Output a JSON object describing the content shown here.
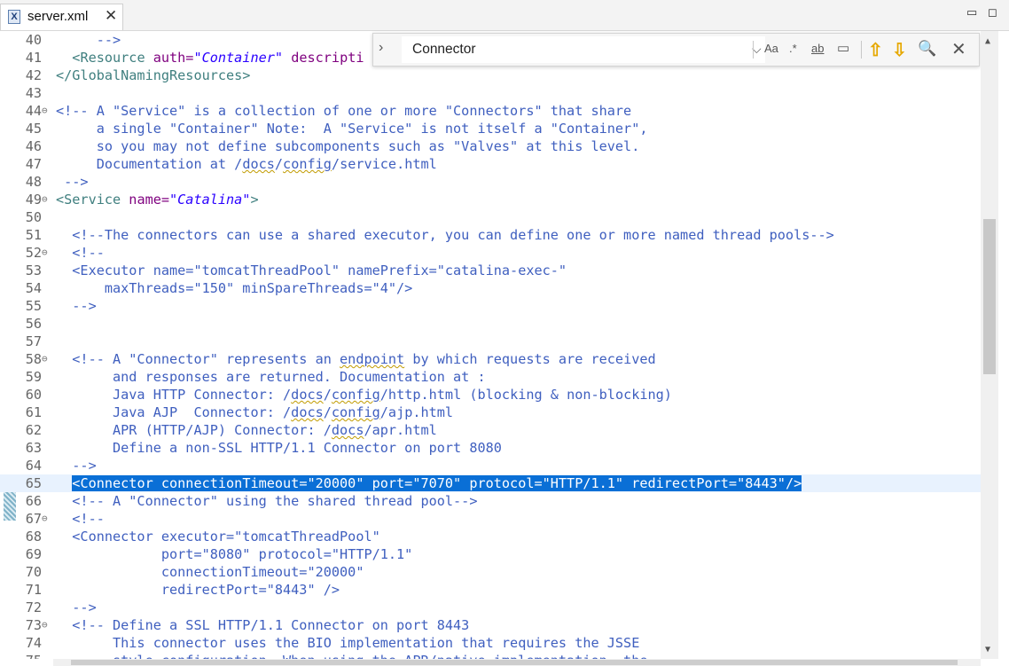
{
  "tab": {
    "file_name": "server.xml",
    "icon": "xml-file-icon",
    "close_glyph": "✕"
  },
  "window_controls": {
    "minimize": "▭",
    "maximize": "◻"
  },
  "find": {
    "query": "Connector",
    "toggle_glyph": "›",
    "history_glyph": "⌵",
    "match_case": "Aa",
    "regex": ".*",
    "whole_word": "ab",
    "in_selection": "▭",
    "prev_glyph": "⇧",
    "next_glyph": "⇩",
    "search_glyph": "🔍",
    "close_glyph": "✕"
  },
  "editor": {
    "lines": [
      {
        "n": "40",
        "fold": "",
        "segs": [
          [
            "c",
            "     -->"
          ]
        ]
      },
      {
        "n": "41",
        "fold": "",
        "segs": [
          [
            "c",
            "  "
          ],
          [
            "t",
            "<Resource "
          ],
          [
            "a",
            "auth="
          ],
          [
            "v",
            "\"Container\""
          ],
          [
            "c",
            " "
          ],
          [
            "a",
            "descripti"
          ]
        ]
      },
      {
        "n": "42",
        "fold": "",
        "segs": [
          [
            "t",
            "</GlobalNamingResources>"
          ]
        ]
      },
      {
        "n": "43",
        "fold": "",
        "segs": [
          [
            "c",
            ""
          ]
        ]
      },
      {
        "n": "44",
        "fold": "⊖",
        "segs": [
          [
            "c",
            "<!-- A \"Service\" is a collection of one or more \"Connectors\" that share"
          ]
        ]
      },
      {
        "n": "45",
        "fold": "",
        "segs": [
          [
            "c",
            "     a single \"Container\" Note:  A \"Service\" is not itself a \"Container\","
          ]
        ]
      },
      {
        "n": "46",
        "fold": "",
        "segs": [
          [
            "c",
            "     so you may not define subcomponents such as \"Valves\" at this level."
          ]
        ]
      },
      {
        "n": "47",
        "fold": "",
        "segs": [
          [
            "c",
            "     Documentation at /"
          ],
          [
            "s",
            "docs"
          ],
          [
            "c",
            "/"
          ],
          [
            "s",
            "config"
          ],
          [
            "c",
            "/service.html"
          ]
        ]
      },
      {
        "n": "48",
        "fold": "",
        "segs": [
          [
            "c",
            " -->"
          ]
        ]
      },
      {
        "n": "49",
        "fold": "⊖",
        "segs": [
          [
            "t",
            "<Service "
          ],
          [
            "a",
            "name="
          ],
          [
            "v",
            "\"Catalina\""
          ],
          [
            "t",
            ">"
          ]
        ]
      },
      {
        "n": "50",
        "fold": "",
        "segs": [
          [
            "c",
            ""
          ]
        ]
      },
      {
        "n": "51",
        "fold": "",
        "segs": [
          [
            "c",
            "  <!--The connectors can use a shared executor, you can define one or more named thread pools-->"
          ]
        ]
      },
      {
        "n": "52",
        "fold": "⊖",
        "segs": [
          [
            "c",
            "  <!--"
          ]
        ]
      },
      {
        "n": "53",
        "fold": "",
        "segs": [
          [
            "c",
            "  <Executor name=\"tomcatThreadPool\" namePrefix=\"catalina-exec-\""
          ]
        ]
      },
      {
        "n": "54",
        "fold": "",
        "segs": [
          [
            "c",
            "      maxThreads=\"150\" minSpareThreads=\"4\"/>"
          ]
        ]
      },
      {
        "n": "55",
        "fold": "",
        "segs": [
          [
            "c",
            "  -->"
          ]
        ]
      },
      {
        "n": "56",
        "fold": "",
        "segs": [
          [
            "c",
            ""
          ]
        ]
      },
      {
        "n": "57",
        "fold": "",
        "segs": [
          [
            "c",
            ""
          ]
        ]
      },
      {
        "n": "58",
        "fold": "⊖",
        "segs": [
          [
            "c",
            "  <!-- A \"Connector\" represents an "
          ],
          [
            "s",
            "endpoint"
          ],
          [
            "c",
            " by which requests are received"
          ]
        ]
      },
      {
        "n": "59",
        "fold": "",
        "segs": [
          [
            "c",
            "       and responses are returned. Documentation at :"
          ]
        ]
      },
      {
        "n": "60",
        "fold": "",
        "segs": [
          [
            "c",
            "       Java HTTP Connector: /"
          ],
          [
            "s",
            "docs"
          ],
          [
            "c",
            "/"
          ],
          [
            "s",
            "config"
          ],
          [
            "c",
            "/http.html (blocking & non-blocking)"
          ]
        ]
      },
      {
        "n": "61",
        "fold": "",
        "segs": [
          [
            "c",
            "       Java AJP  Connector: /"
          ],
          [
            "s",
            "docs"
          ],
          [
            "c",
            "/"
          ],
          [
            "s",
            "config"
          ],
          [
            "c",
            "/ajp.html"
          ]
        ]
      },
      {
        "n": "62",
        "fold": "",
        "segs": [
          [
            "c",
            "       APR (HTTP/AJP) Connector: /"
          ],
          [
            "s",
            "docs"
          ],
          [
            "c",
            "/apr.html"
          ]
        ]
      },
      {
        "n": "63",
        "fold": "",
        "segs": [
          [
            "c",
            "       Define a non-SSL HTTP/1.1 Connector on port 8080"
          ]
        ]
      },
      {
        "n": "64",
        "fold": "",
        "segs": [
          [
            "c",
            "  -->"
          ]
        ]
      },
      {
        "n": "65",
        "fold": "",
        "hl": true,
        "pre": "  ",
        "sel": "<Connector connectionTimeout=\"20000\" port=\"7070\" protocol=\"HTTP/1.1\" redirectPort=\"8443\"/>"
      },
      {
        "n": "66",
        "fold": "",
        "segs": [
          [
            "c",
            "  <!-- A \"Connector\" using the shared thread pool-->"
          ]
        ]
      },
      {
        "n": "67",
        "fold": "⊖",
        "segs": [
          [
            "c",
            "  <!--"
          ]
        ]
      },
      {
        "n": "68",
        "fold": "",
        "segs": [
          [
            "c",
            "  <Connector executor=\"tomcatThreadPool\""
          ]
        ]
      },
      {
        "n": "69",
        "fold": "",
        "segs": [
          [
            "c",
            "             port=\"8080\" protocol=\"HTTP/1.1\""
          ]
        ]
      },
      {
        "n": "70",
        "fold": "",
        "segs": [
          [
            "c",
            "             connectionTimeout=\"20000\""
          ]
        ]
      },
      {
        "n": "71",
        "fold": "",
        "segs": [
          [
            "c",
            "             redirectPort=\"8443\" />"
          ]
        ]
      },
      {
        "n": "72",
        "fold": "",
        "segs": [
          [
            "c",
            "  -->"
          ]
        ]
      },
      {
        "n": "73",
        "fold": "⊖",
        "segs": [
          [
            "c",
            "  <!-- Define a SSL HTTP/1.1 Connector on port 8443"
          ]
        ]
      },
      {
        "n": "74",
        "fold": "",
        "segs": [
          [
            "c",
            "       This connector uses the BIO implementation that requires the JSSE"
          ]
        ]
      },
      {
        "n": "75",
        "fold": "",
        "segs": [
          [
            "c",
            "       style configuration. When using the APR/native implementation, the"
          ]
        ]
      }
    ]
  },
  "colors": {
    "comment": "#3f5fbf",
    "tag": "#3f7f7f",
    "attribute": "#7f007f",
    "value": "#2a00ff",
    "selection": "#0a6fd6",
    "current_line": "#e8f2fe"
  }
}
